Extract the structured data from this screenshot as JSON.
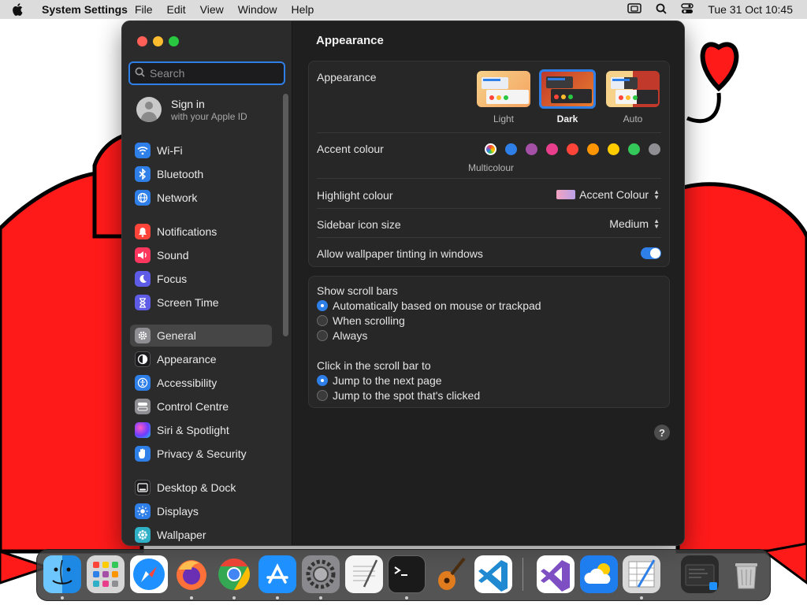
{
  "menubar": {
    "app": "System Settings",
    "menus": [
      "File",
      "Edit",
      "View",
      "Window",
      "Help"
    ],
    "datetime": "Tue 31 Oct  10:45"
  },
  "sidebar": {
    "search_placeholder": "Search",
    "signin_title": "Sign in",
    "signin_sub": "with your Apple ID",
    "items": [
      {
        "label": "Wi-Fi",
        "icon": "wifi-icon",
        "color": "#2f7fe8"
      },
      {
        "label": "Bluetooth",
        "icon": "bluetooth-icon",
        "color": "#2f7fe8"
      },
      {
        "label": "Network",
        "icon": "globe-icon",
        "color": "#2f7fe8"
      },
      {
        "label": "Notifications",
        "icon": "bell-icon",
        "color": "#ff453a"
      },
      {
        "label": "Sound",
        "icon": "speaker-icon",
        "color": "#ff375f"
      },
      {
        "label": "Focus",
        "icon": "moon-icon",
        "color": "#5e5ce6"
      },
      {
        "label": "Screen Time",
        "icon": "hourglass-icon",
        "color": "#5e5ce6"
      },
      {
        "label": "General",
        "icon": "gear-icon",
        "color": "#8e8e93"
      },
      {
        "label": "Appearance",
        "icon": "appearance-icon",
        "color": "#1c1c1e"
      },
      {
        "label": "Accessibility",
        "icon": "accessibility-icon",
        "color": "#2f7fe8"
      },
      {
        "label": "Control Centre",
        "icon": "control-centre-icon",
        "color": "#8e8e93"
      },
      {
        "label": "Siri & Spotlight",
        "icon": "siri-icon",
        "color": "#bf5af2"
      },
      {
        "label": "Privacy & Security",
        "icon": "hand-icon",
        "color": "#2f7fe8"
      },
      {
        "label": "Desktop & Dock",
        "icon": "dock-icon",
        "color": "#1c1c1e"
      },
      {
        "label": "Displays",
        "icon": "sun-icon",
        "color": "#2f7fe8"
      },
      {
        "label": "Wallpaper",
        "icon": "wallpaper-icon",
        "color": "#30b0c7"
      }
    ],
    "selected": "General"
  },
  "pane": {
    "title": "Appearance",
    "appearance_label": "Appearance",
    "modes": [
      "Light",
      "Dark",
      "Auto"
    ],
    "selected_mode": "Dark",
    "accent_label": "Accent colour",
    "accent_colors": [
      "multicolour",
      "#2f7fe8",
      "#a550a7",
      "#e83e8c",
      "#ff453a",
      "#ff9500",
      "#ffcc00",
      "#34c759",
      "#8e8e93"
    ],
    "multicolour_caption": "Multicolour",
    "highlight_label": "Highlight colour",
    "highlight_value": "Accent Colour",
    "sidebar_icon_label": "Sidebar icon size",
    "sidebar_icon_value": "Medium",
    "tinting_label": "Allow wallpaper tinting in windows",
    "tinting_on": true,
    "scrollbars_label": "Show scroll bars",
    "scroll_options": [
      "Automatically based on mouse or trackpad",
      "When scrolling",
      "Always"
    ],
    "click_label": "Click in the scroll bar to",
    "click_options": [
      "Jump to the next page",
      "Jump to the spot that's clicked"
    ],
    "help": "?"
  },
  "dock": {
    "apps": [
      "finder-icon",
      "launchpad-icon",
      "safari-icon",
      "firefox-icon",
      "chrome-icon",
      "app-store-icon",
      "system-settings-icon",
      "textedit-icon",
      "terminal-icon",
      "garageband-icon",
      "vscode-icon",
      "visual-studio-icon",
      "icloud-icon",
      "script-editor-icon",
      "downloads-icon",
      "trash-icon"
    ]
  }
}
